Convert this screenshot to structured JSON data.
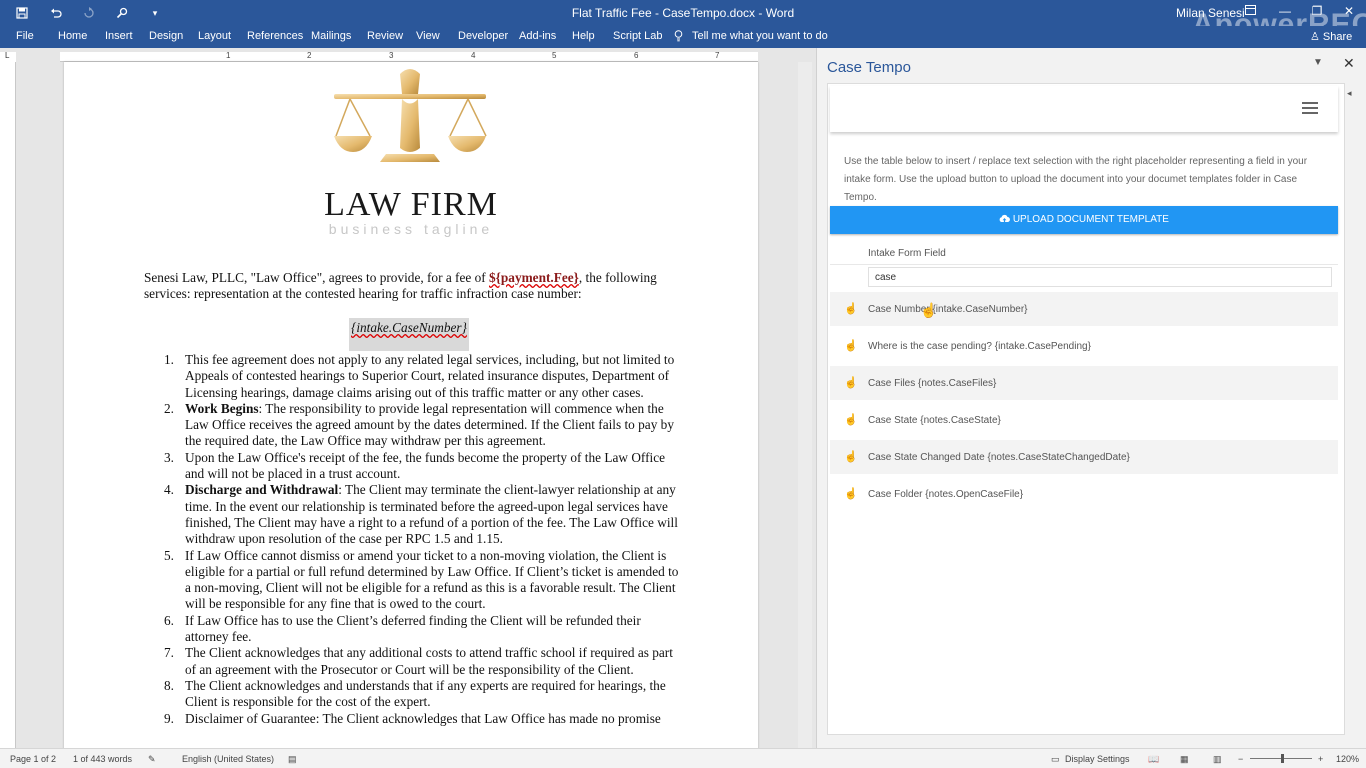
{
  "window": {
    "title": "Flat Traffic Fee - CaseTempo.docx - Word",
    "user": "Milan Senesi",
    "watermark": "ApowerREC"
  },
  "ribbon": {
    "tabs": [
      "File",
      "Home",
      "Insert",
      "Design",
      "Layout",
      "References",
      "Mailings",
      "Review",
      "View",
      "Developer",
      "Add-ins",
      "Help",
      "Script Lab"
    ],
    "tell_me": "Tell me what you want to do",
    "share": "Share"
  },
  "ruler": {
    "marks": [
      "1",
      "2",
      "3",
      "4",
      "5",
      "6",
      "7"
    ]
  },
  "document": {
    "firm_name": "LAW FIRM",
    "tagline": "business tagline",
    "intro_part1": "Senesi Law, PLLC, \"Law Office\", agrees to provide, for a fee of ",
    "intro_fee": "${payment.Fee}",
    "intro_part2": ", the following services: representation at the contested hearing for traffic infraction case number:",
    "case_placeholder": "{intake.CaseNumber}",
    "terms": [
      {
        "num": "1.",
        "bold": "",
        "text": "This fee agreement does not apply to any related legal services, including, but not limited to Appeals of contested hearings to Superior Court, related insurance disputes, Department of Licensing hearings, damage claims arising out of this traffic matter or any other cases."
      },
      {
        "num": "2.",
        "bold": "Work Begins",
        "text": ": The responsibility to provide legal representation will commence when the Law Office receives the agreed amount by the dates determined. If the Client fails to pay by the required date, the Law Office may withdraw per this agreement."
      },
      {
        "num": "3.",
        "bold": "",
        "text": "Upon the Law Office's receipt of the fee, the funds become the property of the Law Office and will not be placed in a trust account."
      },
      {
        "num": "4.",
        "bold": "Discharge and Withdrawal",
        "text": ": The Client may terminate the client-lawyer relationship at any time. In the event our relationship is terminated before the agreed-upon legal services have finished, The Client may have a right to a refund of a portion of the fee. The Law Office will withdraw upon resolution of the case per RPC 1.5 and 1.15."
      },
      {
        "num": "5.",
        "bold": "",
        "text": "If Law Office cannot dismiss or amend your ticket to a non-moving violation, the Client is eligible for a partial or full refund determined by Law Office.  If Client’s ticket is amended to a non-moving, Client will not be eligible for a refund as this is a favorable result. The Client will be responsible for any fine that is owed to the court."
      },
      {
        "num": "6.",
        "bold": "",
        "text": "If Law Office has to use the Client’s deferred finding the Client will be refunded their attorney fee."
      },
      {
        "num": "7.",
        "bold": "",
        "text": "The Client acknowledges that any additional costs to attend traffic school if required as part of an agreement with the Prosecutor or Court will be the responsibility of the Client."
      },
      {
        "num": "8.",
        "bold": "",
        "text": "The Client acknowledges and understands that if any experts are required for hearings, the Client is responsible for the cost of the expert."
      },
      {
        "num": "9.",
        "bold": "",
        "text": "Disclaimer of Guarantee: The Client acknowledges that Law Office has made no promise"
      }
    ]
  },
  "pane": {
    "title": "Case Tempo",
    "instructions": "Use the table below to insert / replace text selection with the right placeholder representing a field in your intake form. Use the upload button to upload the document into your documet templates folder in Case Tempo.",
    "upload_label": "UPLOAD DOCUMENT TEMPLATE",
    "field_header": "Intake Form Field",
    "search_value": "case",
    "fields": [
      "Case Number {intake.CaseNumber}",
      "Where is the case pending? {intake.CasePending}",
      "Case Files {notes.CaseFiles}",
      "Case State {notes.CaseState}",
      "Case State Changed Date {notes.CaseStateChangedDate}",
      "Case Folder {notes.OpenCaseFile}"
    ],
    "accent": "#2196f3"
  },
  "status": {
    "page": "Page 1 of 2",
    "words": "1 of 443 words",
    "language": "English (United States)",
    "display_settings": "Display Settings",
    "zoom": "120%"
  },
  "colors": {
    "word_blue": "#2b579a",
    "upload_blue": "#2196f3"
  }
}
